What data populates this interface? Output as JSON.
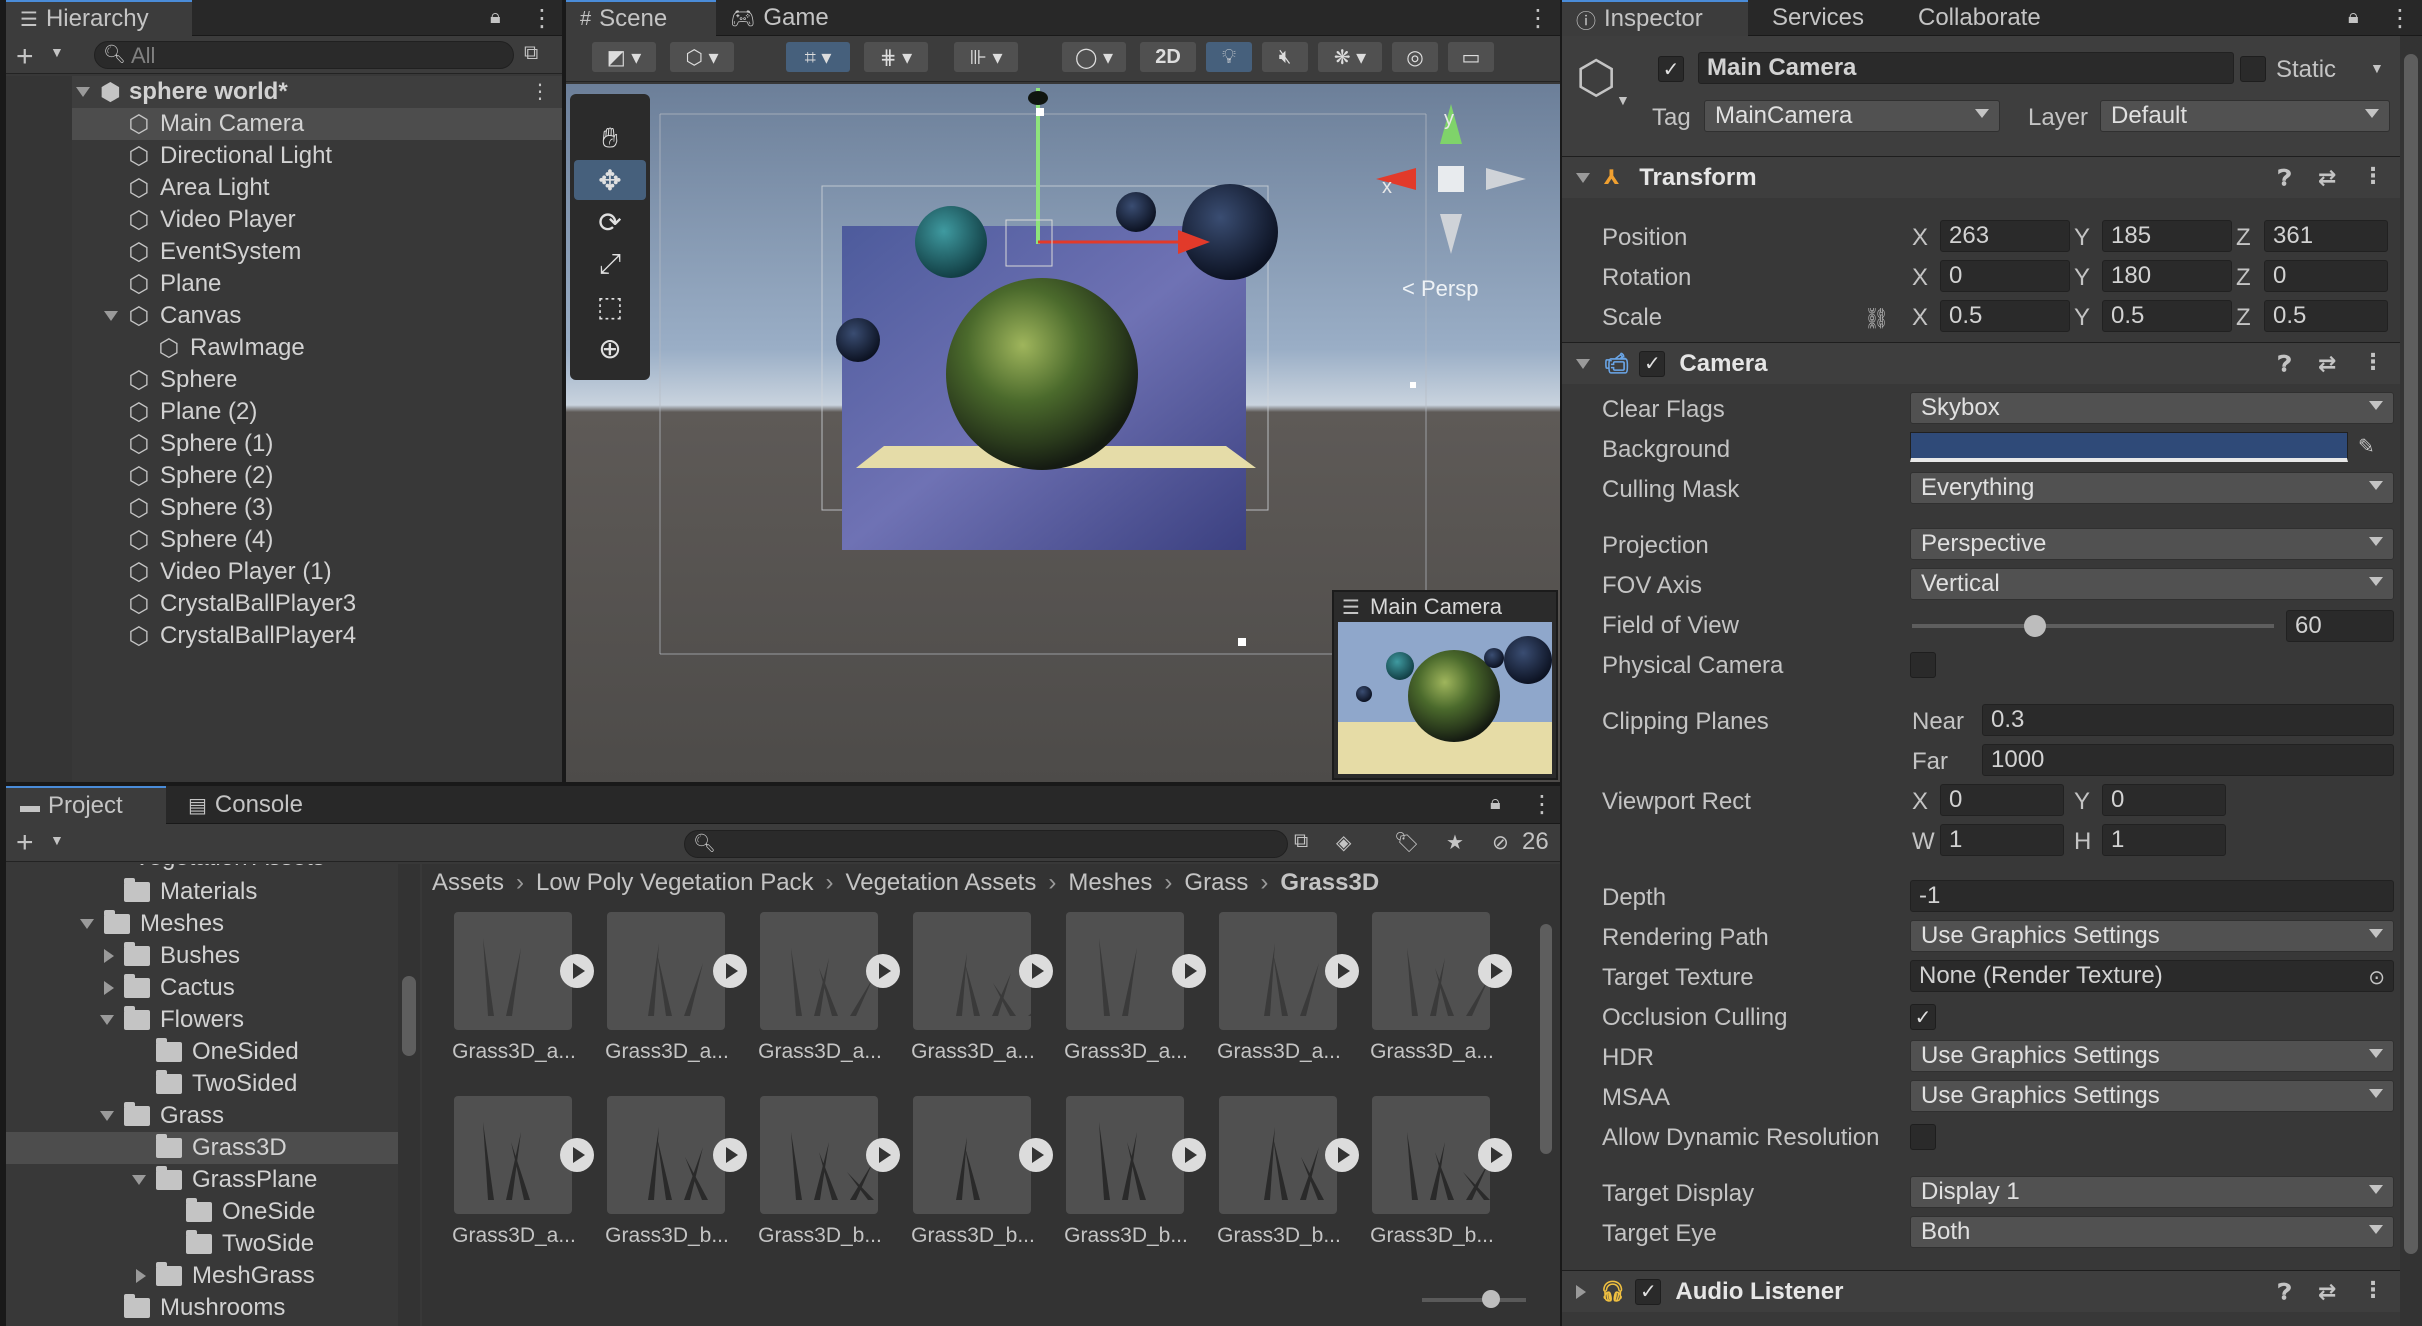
{
  "hierarchy": {
    "tab_label": "Hierarchy",
    "search_placeholder": "All",
    "scene_name": "sphere world*",
    "items": [
      {
        "label": "Main Camera",
        "selected": true
      },
      {
        "label": "Directional Light"
      },
      {
        "label": "Area Light"
      },
      {
        "label": "Video Player"
      },
      {
        "label": "EventSystem"
      },
      {
        "label": "Plane"
      },
      {
        "label": "Canvas",
        "expanded": true
      },
      {
        "label": "RawImage",
        "child": true
      },
      {
        "label": "Sphere"
      },
      {
        "label": "Plane (2)"
      },
      {
        "label": "Sphere (1)"
      },
      {
        "label": "Sphere (2)"
      },
      {
        "label": "Sphere (3)"
      },
      {
        "label": "Sphere (4)"
      },
      {
        "label": "Video Player (1)"
      },
      {
        "label": "CrystalBallPlayer3"
      },
      {
        "label": "CrystalBallPlayer4"
      }
    ]
  },
  "scene": {
    "tab_scene": "Scene",
    "tab_game": "Game",
    "btn_2d": "2D",
    "persp_label": "< Persp",
    "axis_x": "x",
    "axis_y": "y",
    "camera_preview_title": "Main Camera"
  },
  "project": {
    "tab_project": "Project",
    "tab_console": "Console",
    "hidden_count": "26",
    "clipped_item": "Vegetation Assets",
    "tree": [
      {
        "label": "Materials",
        "indent": 1
      },
      {
        "label": "Meshes",
        "indent": 0,
        "expanded": true
      },
      {
        "label": "Bushes",
        "indent": 2,
        "collapsed": true
      },
      {
        "label": "Cactus",
        "indent": 2,
        "collapsed": true
      },
      {
        "label": "Flowers",
        "indent": 2,
        "expanded": true
      },
      {
        "label": "OneSided",
        "indent": 3
      },
      {
        "label": "TwoSided",
        "indent": 3
      },
      {
        "label": "Grass",
        "indent": 2,
        "expanded": true
      },
      {
        "label": "Grass3D",
        "indent": 3,
        "selected": true
      },
      {
        "label": "GrassPlane",
        "indent": 3,
        "expanded": true
      },
      {
        "label": "OneSide",
        "indent": 4
      },
      {
        "label": "TwoSide",
        "indent": 4
      },
      {
        "label": "MeshGrass",
        "indent": 3,
        "collapsed": true
      },
      {
        "label": "Mushrooms",
        "indent": 1
      }
    ],
    "breadcrumb": [
      "Assets",
      "Low Poly Vegetation Pack",
      "Vegetation Assets",
      "Meshes",
      "Grass",
      "Grass3D"
    ],
    "assets_row1": [
      "Grass3D_a...",
      "Grass3D_a...",
      "Grass3D_a...",
      "Grass3D_a...",
      "Grass3D_a...",
      "Grass3D_a...",
      "Grass3D_a..."
    ],
    "assets_row2": [
      "Grass3D_a...",
      "Grass3D_b...",
      "Grass3D_b...",
      "Grass3D_b...",
      "Grass3D_b...",
      "Grass3D_b...",
      "Grass3D_b..."
    ]
  },
  "inspector": {
    "tab_inspector": "Inspector",
    "tab_services": "Services",
    "tab_collaborate": "Collaborate",
    "object_name": "Main Camera",
    "static_label": "Static",
    "tag_label": "Tag",
    "tag_value": "MainCamera",
    "layer_label": "Layer",
    "layer_value": "Default",
    "transform": {
      "title": "Transform",
      "position_label": "Position",
      "rotation_label": "Rotation",
      "scale_label": "Scale",
      "position": {
        "x": "263",
        "y": "185",
        "z": "361"
      },
      "rotation": {
        "x": "0",
        "y": "180",
        "z": "0"
      },
      "scale": {
        "x": "0.5",
        "y": "0.5",
        "z": "0.5"
      },
      "axis_x": "X",
      "axis_y": "Y",
      "axis_z": "Z"
    },
    "camera": {
      "title": "Camera",
      "clear_flags_label": "Clear Flags",
      "clear_flags_value": "Skybox",
      "background_label": "Background",
      "background_color": "#2f4a78",
      "culling_mask_label": "Culling Mask",
      "culling_mask_value": "Everything",
      "projection_label": "Projection",
      "projection_value": "Perspective",
      "fov_axis_label": "FOV Axis",
      "fov_axis_value": "Vertical",
      "fov_label": "Field of View",
      "fov_value": "60",
      "fov_slider_fraction": 0.34,
      "physical_label": "Physical Camera",
      "clipping_label": "Clipping Planes",
      "near_label": "Near",
      "near_value": "0.3",
      "far_label": "Far",
      "far_value": "1000",
      "viewport_label": "Viewport Rect",
      "vp_x_label": "X",
      "vp_x": "0",
      "vp_y_label": "Y",
      "vp_y": "0",
      "vp_w_label": "W",
      "vp_w": "1",
      "vp_h_label": "H",
      "vp_h": "1",
      "depth_label": "Depth",
      "depth_value": "-1",
      "rendering_path_label": "Rendering Path",
      "rendering_path_value": "Use Graphics Settings",
      "target_texture_label": "Target Texture",
      "target_texture_value": "None (Render Texture)",
      "occlusion_label": "Occlusion Culling",
      "hdr_label": "HDR",
      "hdr_value": "Use Graphics Settings",
      "msaa_label": "MSAA",
      "msaa_value": "Use Graphics Settings",
      "dynres_label": "Allow Dynamic Resolution",
      "target_display_label": "Target Display",
      "target_display_value": "Display 1",
      "target_eye_label": "Target Eye",
      "target_eye_value": "Both"
    },
    "audio_listener_title": "Audio Listener"
  }
}
